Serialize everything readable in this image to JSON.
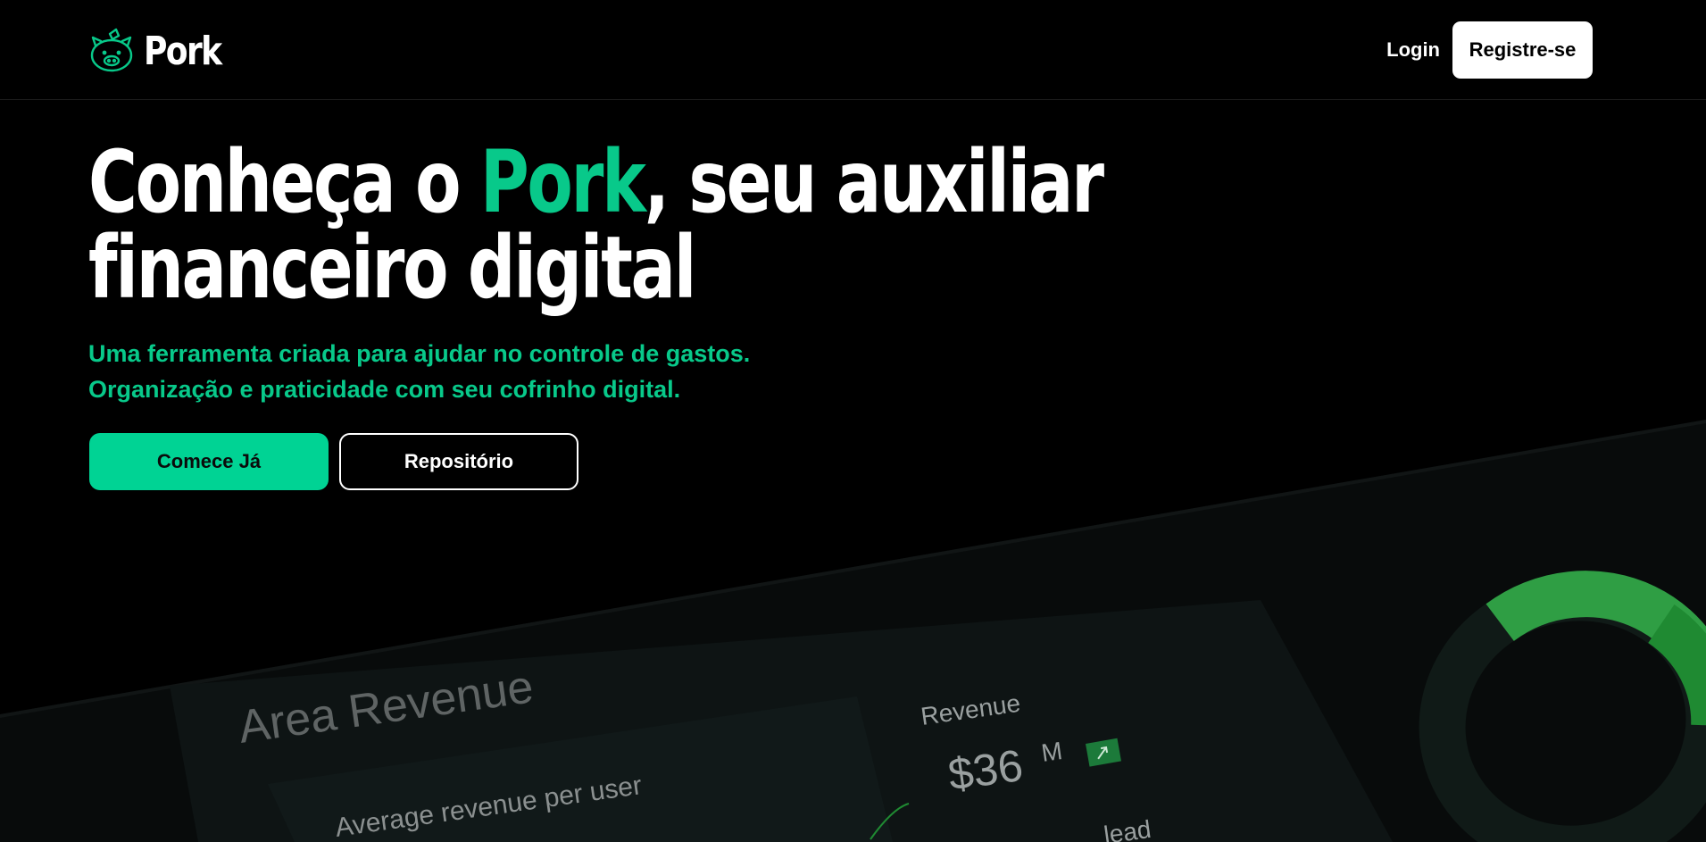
{
  "brand": {
    "name": "Pork",
    "accent_color": "#08c98a",
    "logo_icon": "piggy-bank-icon"
  },
  "nav": {
    "login_label": "Login",
    "register_label": "Registre-se"
  },
  "hero": {
    "title_before": "Conheça o ",
    "title_accent": "Pork",
    "title_after": ", seu auxiliar",
    "title_line2": "financeiro digital",
    "subtitle_line1": "Uma ferramenta criada para ajudar no controle de gastos.",
    "subtitle_line2": "Organização e praticidade com seu cofrinho digital.",
    "primary_cta": "Comece Já",
    "secondary_cta": "Repositório"
  },
  "dashboard_preview": {
    "card_title": "Area Revenue",
    "card_subtitle": "Average revenue per user",
    "revenue_label": "Revenue",
    "revenue_value": "$36",
    "revenue_unit": "M",
    "trend_icon": "trend-up-icon",
    "cut_label": "lead",
    "donut_colors": [
      "#2f9e44",
      "#1f8a32"
    ]
  }
}
